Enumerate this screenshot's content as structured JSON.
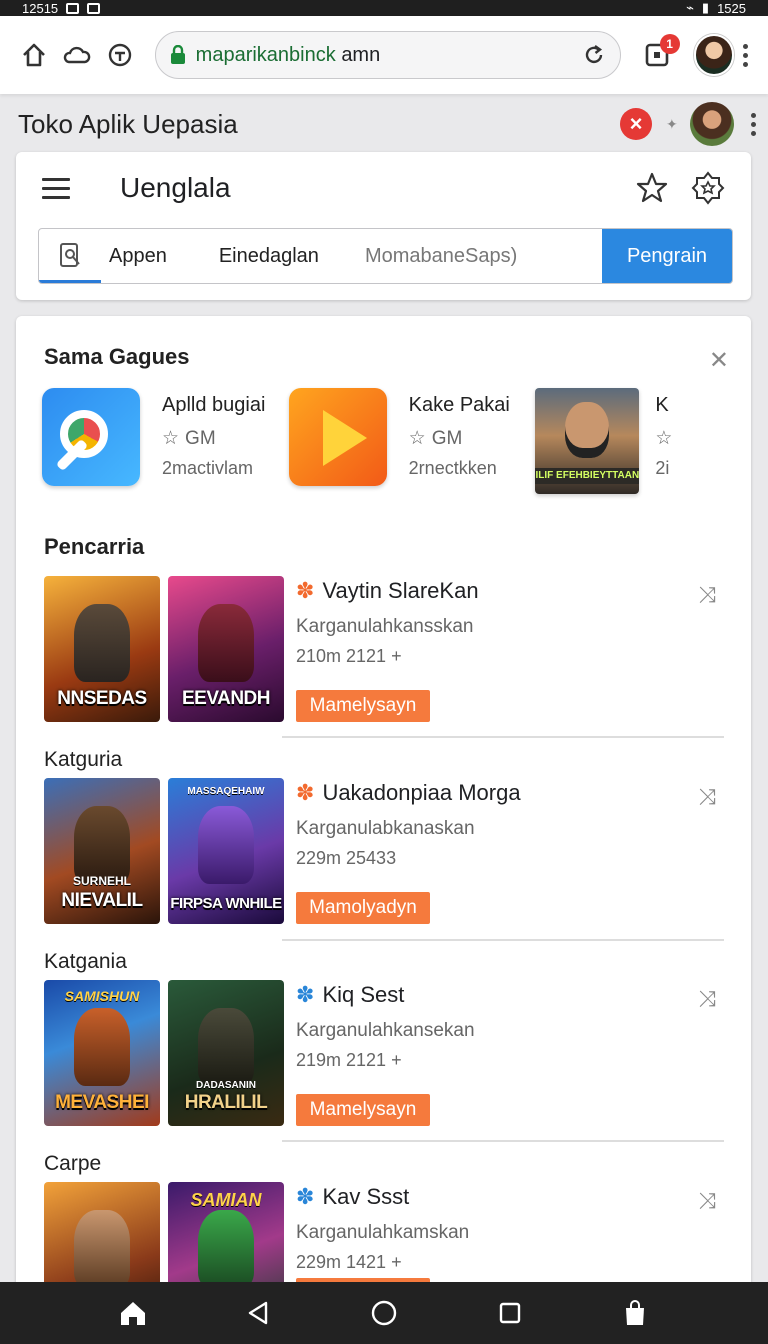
{
  "status_bar": {
    "time_left": "12515",
    "time_right": "1525"
  },
  "browser": {
    "url_host": "maparikanbinck",
    "url_rest": "amn",
    "tab_count": "1"
  },
  "page": {
    "heading": "Toko Aplik Uepasia",
    "app_title": "Uenglala",
    "search": {
      "chips": [
        "Appen",
        "Einedaglan"
      ],
      "placeholder": "MomabaneSaps)",
      "button_label": "Pengrain"
    }
  },
  "featured_section": {
    "title": "Sama Gagues",
    "items": [
      {
        "name": "Aplld bugiai",
        "rating": "GM",
        "sub": "2mactivlam",
        "icon": "search-lens-app-icon"
      },
      {
        "name": "Kake Pakai",
        "rating": "GM",
        "sub": "2rnectkken",
        "icon": "play-app-icon"
      },
      {
        "name": "K",
        "rating": "",
        "sub": "2i",
        "icon": "hero-portrait-app-icon",
        "banner": "ILIF EFEHBIEYTTAAN"
      }
    ]
  },
  "list_sections": [
    {
      "label": "Pencarria",
      "thumb_captions": [
        "NNSEDAS",
        "EEVANDH"
      ],
      "thumb_tops": [
        "",
        ""
      ],
      "app_name": "Vaytin SlareKan",
      "badge_color": "#f26a2e",
      "developer": "Karganulahkansskan",
      "stats": "210m 2121 +",
      "install_label": "Mamelysayn"
    },
    {
      "label": "Katguria",
      "thumb_captions": [
        "NIEVALIL",
        "FIRPSA WNHILE"
      ],
      "thumb_tops": [
        "SURNEHL",
        "MASSAQEHAIW"
      ],
      "app_name": "Uakadonpiaa Morga",
      "badge_color": "#f26a2e",
      "developer": "Karganulabkanaskan",
      "stats": "229m 25433",
      "install_label": "Mamolyadyn"
    },
    {
      "label": "Katgania",
      "thumb_captions": [
        "MEVASHEI",
        "HRALILIL"
      ],
      "thumb_tops": [
        "SAMISHUN",
        "DADASANIN"
      ],
      "app_name": "Kiq Sest",
      "badge_color": "#2a86d8",
      "developer": "Karganulahkansekan",
      "stats": "219m 2121 +",
      "install_label": "Mamelysayn"
    },
    {
      "label": "Carpe",
      "thumb_captions": [
        "",
        ""
      ],
      "thumb_tops": [
        "",
        "SAMIAN"
      ],
      "app_name": "Kav Ssst",
      "badge_color": "#2a86d8",
      "developer": "Karganulahkamskan",
      "stats": "229m 1421 +",
      "install_label": ""
    }
  ],
  "colors": {
    "accent_blue": "#2b88e0",
    "install_orange": "#f57a3d",
    "close_red": "#e53935"
  }
}
